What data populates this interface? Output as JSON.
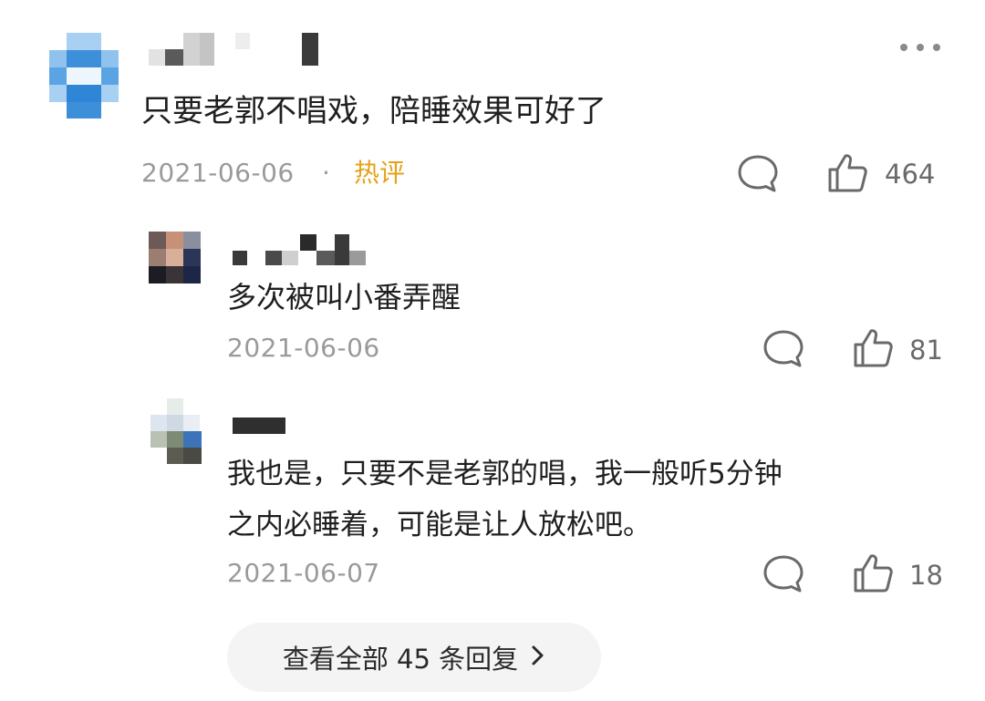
{
  "comment": {
    "text": "只要老郭不唱戏，陪睡效果可好了",
    "date": "2021-06-06",
    "separator": "·",
    "tag": "热评",
    "like_count": "464",
    "more_icon": "more-dots-icon",
    "reply_icon": "comment-bubble-icon",
    "like_icon": "thumbs-up-icon"
  },
  "replies": [
    {
      "text": "多次被叫小番弄醒",
      "date": "2021-06-06",
      "like_count": "81"
    },
    {
      "text_line1": "我也是，只要不是老郭的唱，我一般听5分钟",
      "text_line2": "之内必睡着，可能是让人放松吧。",
      "date": "2021-06-07",
      "like_count": "18"
    }
  ],
  "view_all": {
    "label": "查看全部 45 条回复",
    "icon": "chevron-right-icon"
  },
  "colors": {
    "tag": "#e3a21a",
    "meta": "#9a9a9a",
    "pill_bg": "#f4f4f5",
    "avatar_blue": "#3d8fd9"
  }
}
